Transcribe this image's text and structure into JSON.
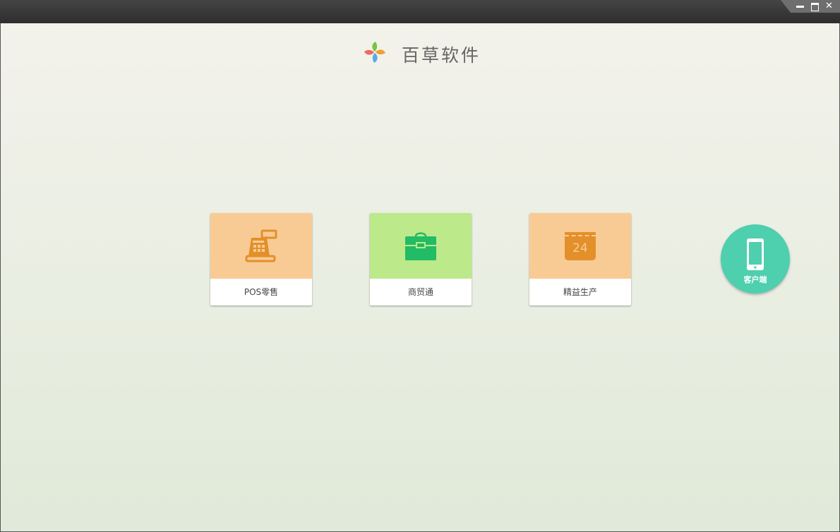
{
  "window": {
    "controls": {
      "minimize": "minimize-icon",
      "maximize": "maximize-icon",
      "close": "close-icon",
      "close_glyph": "✕"
    }
  },
  "header": {
    "brand": "百草软件",
    "logo_colors": [
      "#7dc242",
      "#f0a030",
      "#5aa9e6",
      "#ef6b5b"
    ]
  },
  "modules": [
    {
      "label": "POS零售",
      "icon": "cash-register-icon",
      "color": "#f9cb94",
      "icon_color": "#e3902a"
    },
    {
      "label": "商贸通",
      "icon": "briefcase-icon",
      "color": "#bce98a",
      "icon_color": "#22bb66"
    },
    {
      "label": "精益生产",
      "icon": "calendar-icon",
      "color": "#f9cb94",
      "icon_color": "#e3902a",
      "icon_text": "24"
    }
  ],
  "client": {
    "label": "客户端",
    "icon": "mobile-phone-icon",
    "color": "#4ecfae"
  }
}
